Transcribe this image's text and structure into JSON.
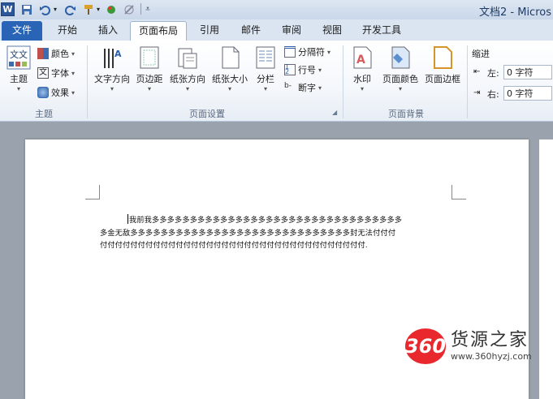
{
  "titlebar": {
    "app_icon": "word-logo",
    "app_letter": "W",
    "quick_access_icons": [
      "save-icon",
      "undo-icon",
      "redo-icon",
      "format-painter-icon",
      "color-icon",
      "clear-format-icon",
      "customize-icon"
    ],
    "title": "文档2 - Micros"
  },
  "tabs": [
    {
      "label": "文件",
      "state": "file"
    },
    {
      "label": "开始",
      "state": "normal"
    },
    {
      "label": "插入",
      "state": "normal"
    },
    {
      "label": "页面布局",
      "state": "active"
    },
    {
      "label": "引用",
      "state": "normal"
    },
    {
      "label": "邮件",
      "state": "normal"
    },
    {
      "label": "审阅",
      "state": "normal"
    },
    {
      "label": "视图",
      "state": "normal"
    },
    {
      "label": "开发工具",
      "state": "normal"
    }
  ],
  "ribbon": {
    "theme_group": {
      "label": "主题",
      "themes_button": "主题",
      "colors_button": "颜色",
      "fonts_button": "字体",
      "effects_button": "效果"
    },
    "page_setup_group": {
      "label": "页面设置",
      "text_direction": "文字方向",
      "margins": "页边距",
      "orientation": "纸张方向",
      "size": "纸张大小",
      "columns": "分栏",
      "breaks": "分隔符",
      "line_numbers": "行号",
      "hyphenation": "断字"
    },
    "page_background_group": {
      "label": "页面背景",
      "watermark": "水印",
      "page_color": "页面颜色",
      "page_borders": "页面边框"
    },
    "indent_group": {
      "label": "缩进",
      "left_label": "左:",
      "left_value": "0 字符",
      "right_label": "右:",
      "right_value": "0 字符"
    }
  },
  "document": {
    "line1": "我前我多多多多多多多多多多多多多多多多多多多多多多多多多多多多多多多多多",
    "line2": "多金无敌多多多多多多多多多多多多多多多多多多多多多多多多多多多多多封无法付付付",
    "line3": "付付付付付付付付付付付付付付付付付付付付付付付付付付付付付付付付付付付."
  },
  "watermark_site": {
    "logo_text": "360",
    "name": "货源之家",
    "url": "www.360hyzj.com"
  },
  "colors": {
    "file_tab": "#2a64b7",
    "ribbon_bg": "#f4f7fb",
    "workspace": "#9aa3ad",
    "logo_red": "#e8282c"
  }
}
